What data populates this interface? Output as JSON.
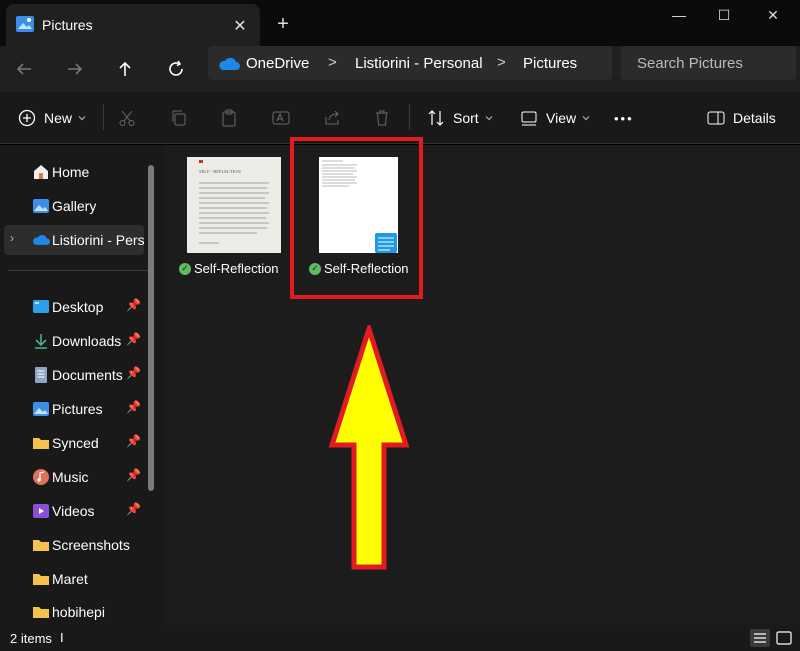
{
  "window": {
    "tab_title": "Pictures",
    "tab_close": "✕",
    "new_tab": "+",
    "minimize": "—",
    "maximize": "☐",
    "close": "✕"
  },
  "address": {
    "breadcrumb": [
      "OneDrive",
      "Listiorini - Personal",
      "Pictures"
    ],
    "separator": ">",
    "search_placeholder": "Search Pictures"
  },
  "commands": {
    "new_label": "New",
    "sort_label": "Sort",
    "view_label": "View",
    "more_label": "•••",
    "details_label": "Details"
  },
  "sidebar": {
    "items": [
      {
        "label": "Home",
        "icon": "home-icon"
      },
      {
        "label": "Gallery",
        "icon": "gallery-icon"
      },
      {
        "label": "Listiorini - Personal",
        "icon": "onedrive-icon"
      },
      {
        "label": "Desktop",
        "icon": "desktop-icon"
      },
      {
        "label": "Downloads",
        "icon": "downloads-icon"
      },
      {
        "label": "Documents",
        "icon": "documents-icon"
      },
      {
        "label": "Pictures",
        "icon": "pictures-icon"
      },
      {
        "label": "Synced",
        "icon": "folder-icon"
      },
      {
        "label": "Music",
        "icon": "music-icon"
      },
      {
        "label": "Videos",
        "icon": "videos-icon"
      },
      {
        "label": "Screenshots",
        "icon": "folder-icon"
      },
      {
        "label": "Maret",
        "icon": "folder-icon"
      },
      {
        "label": "hobihepi",
        "icon": "folder-icon"
      }
    ],
    "pin_glyph": "📌"
  },
  "files": [
    {
      "name": "Self-Reflection",
      "type": "image",
      "thumb_title": "SELF - REFLECTION"
    },
    {
      "name": "Self-Reflection",
      "type": "notepad"
    }
  ],
  "status": {
    "item_count": "2 items",
    "cursor": "I"
  },
  "colors": {
    "highlight": "#e21b23",
    "arrow_fill": "#ffff00",
    "accent": "#4cc2ff",
    "folder": "#f4c24d"
  }
}
